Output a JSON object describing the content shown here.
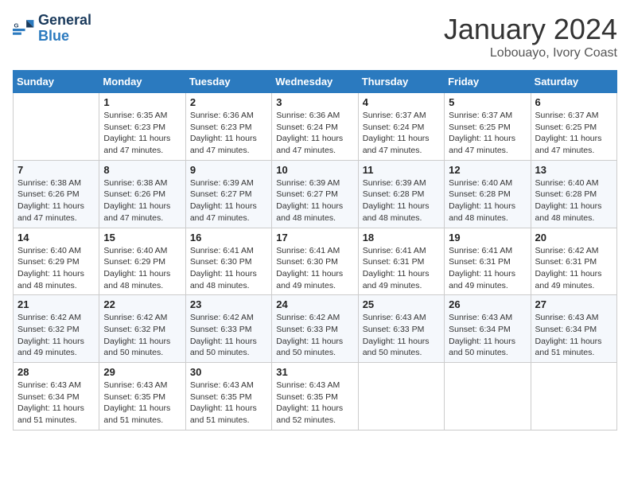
{
  "logo": {
    "line1": "General",
    "line2": "Blue"
  },
  "title": "January 2024",
  "location": "Lobouayo, Ivory Coast",
  "weekdays": [
    "Sunday",
    "Monday",
    "Tuesday",
    "Wednesday",
    "Thursday",
    "Friday",
    "Saturday"
  ],
  "weeks": [
    [
      {
        "day": "",
        "sunrise": "",
        "sunset": "",
        "daylight": ""
      },
      {
        "day": "1",
        "sunrise": "Sunrise: 6:35 AM",
        "sunset": "Sunset: 6:23 PM",
        "daylight": "Daylight: 11 hours and 47 minutes."
      },
      {
        "day": "2",
        "sunrise": "Sunrise: 6:36 AM",
        "sunset": "Sunset: 6:23 PM",
        "daylight": "Daylight: 11 hours and 47 minutes."
      },
      {
        "day": "3",
        "sunrise": "Sunrise: 6:36 AM",
        "sunset": "Sunset: 6:24 PM",
        "daylight": "Daylight: 11 hours and 47 minutes."
      },
      {
        "day": "4",
        "sunrise": "Sunrise: 6:37 AM",
        "sunset": "Sunset: 6:24 PM",
        "daylight": "Daylight: 11 hours and 47 minutes."
      },
      {
        "day": "5",
        "sunrise": "Sunrise: 6:37 AM",
        "sunset": "Sunset: 6:25 PM",
        "daylight": "Daylight: 11 hours and 47 minutes."
      },
      {
        "day": "6",
        "sunrise": "Sunrise: 6:37 AM",
        "sunset": "Sunset: 6:25 PM",
        "daylight": "Daylight: 11 hours and 47 minutes."
      }
    ],
    [
      {
        "day": "7",
        "sunrise": "Sunrise: 6:38 AM",
        "sunset": "Sunset: 6:26 PM",
        "daylight": "Daylight: 11 hours and 47 minutes."
      },
      {
        "day": "8",
        "sunrise": "Sunrise: 6:38 AM",
        "sunset": "Sunset: 6:26 PM",
        "daylight": "Daylight: 11 hours and 47 minutes."
      },
      {
        "day": "9",
        "sunrise": "Sunrise: 6:39 AM",
        "sunset": "Sunset: 6:27 PM",
        "daylight": "Daylight: 11 hours and 47 minutes."
      },
      {
        "day": "10",
        "sunrise": "Sunrise: 6:39 AM",
        "sunset": "Sunset: 6:27 PM",
        "daylight": "Daylight: 11 hours and 48 minutes."
      },
      {
        "day": "11",
        "sunrise": "Sunrise: 6:39 AM",
        "sunset": "Sunset: 6:28 PM",
        "daylight": "Daylight: 11 hours and 48 minutes."
      },
      {
        "day": "12",
        "sunrise": "Sunrise: 6:40 AM",
        "sunset": "Sunset: 6:28 PM",
        "daylight": "Daylight: 11 hours and 48 minutes."
      },
      {
        "day": "13",
        "sunrise": "Sunrise: 6:40 AM",
        "sunset": "Sunset: 6:28 PM",
        "daylight": "Daylight: 11 hours and 48 minutes."
      }
    ],
    [
      {
        "day": "14",
        "sunrise": "Sunrise: 6:40 AM",
        "sunset": "Sunset: 6:29 PM",
        "daylight": "Daylight: 11 hours and 48 minutes."
      },
      {
        "day": "15",
        "sunrise": "Sunrise: 6:40 AM",
        "sunset": "Sunset: 6:29 PM",
        "daylight": "Daylight: 11 hours and 48 minutes."
      },
      {
        "day": "16",
        "sunrise": "Sunrise: 6:41 AM",
        "sunset": "Sunset: 6:30 PM",
        "daylight": "Daylight: 11 hours and 48 minutes."
      },
      {
        "day": "17",
        "sunrise": "Sunrise: 6:41 AM",
        "sunset": "Sunset: 6:30 PM",
        "daylight": "Daylight: 11 hours and 49 minutes."
      },
      {
        "day": "18",
        "sunrise": "Sunrise: 6:41 AM",
        "sunset": "Sunset: 6:31 PM",
        "daylight": "Daylight: 11 hours and 49 minutes."
      },
      {
        "day": "19",
        "sunrise": "Sunrise: 6:41 AM",
        "sunset": "Sunset: 6:31 PM",
        "daylight": "Daylight: 11 hours and 49 minutes."
      },
      {
        "day": "20",
        "sunrise": "Sunrise: 6:42 AM",
        "sunset": "Sunset: 6:31 PM",
        "daylight": "Daylight: 11 hours and 49 minutes."
      }
    ],
    [
      {
        "day": "21",
        "sunrise": "Sunrise: 6:42 AM",
        "sunset": "Sunset: 6:32 PM",
        "daylight": "Daylight: 11 hours and 49 minutes."
      },
      {
        "day": "22",
        "sunrise": "Sunrise: 6:42 AM",
        "sunset": "Sunset: 6:32 PM",
        "daylight": "Daylight: 11 hours and 50 minutes."
      },
      {
        "day": "23",
        "sunrise": "Sunrise: 6:42 AM",
        "sunset": "Sunset: 6:33 PM",
        "daylight": "Daylight: 11 hours and 50 minutes."
      },
      {
        "day": "24",
        "sunrise": "Sunrise: 6:42 AM",
        "sunset": "Sunset: 6:33 PM",
        "daylight": "Daylight: 11 hours and 50 minutes."
      },
      {
        "day": "25",
        "sunrise": "Sunrise: 6:43 AM",
        "sunset": "Sunset: 6:33 PM",
        "daylight": "Daylight: 11 hours and 50 minutes."
      },
      {
        "day": "26",
        "sunrise": "Sunrise: 6:43 AM",
        "sunset": "Sunset: 6:34 PM",
        "daylight": "Daylight: 11 hours and 50 minutes."
      },
      {
        "day": "27",
        "sunrise": "Sunrise: 6:43 AM",
        "sunset": "Sunset: 6:34 PM",
        "daylight": "Daylight: 11 hours and 51 minutes."
      }
    ],
    [
      {
        "day": "28",
        "sunrise": "Sunrise: 6:43 AM",
        "sunset": "Sunset: 6:34 PM",
        "daylight": "Daylight: 11 hours and 51 minutes."
      },
      {
        "day": "29",
        "sunrise": "Sunrise: 6:43 AM",
        "sunset": "Sunset: 6:35 PM",
        "daylight": "Daylight: 11 hours and 51 minutes."
      },
      {
        "day": "30",
        "sunrise": "Sunrise: 6:43 AM",
        "sunset": "Sunset: 6:35 PM",
        "daylight": "Daylight: 11 hours and 51 minutes."
      },
      {
        "day": "31",
        "sunrise": "Sunrise: 6:43 AM",
        "sunset": "Sunset: 6:35 PM",
        "daylight": "Daylight: 11 hours and 52 minutes."
      },
      {
        "day": "",
        "sunrise": "",
        "sunset": "",
        "daylight": ""
      },
      {
        "day": "",
        "sunrise": "",
        "sunset": "",
        "daylight": ""
      },
      {
        "day": "",
        "sunrise": "",
        "sunset": "",
        "daylight": ""
      }
    ]
  ]
}
